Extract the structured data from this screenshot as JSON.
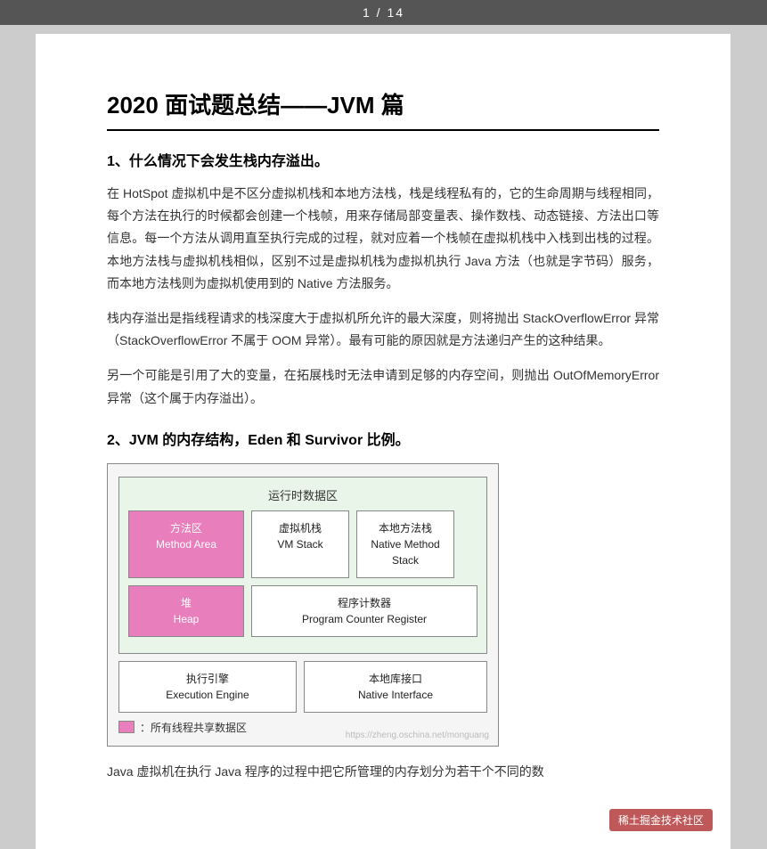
{
  "topbar": {
    "page_indicator": "1 / 14"
  },
  "document": {
    "title": "2020 面试题总结——JVM 篇",
    "section1": {
      "heading": "1、什么情况下会发生栈内存溢出。",
      "paragraphs": [
        "在 HotSpot 虚拟机中是不区分虚拟机栈和本地方法栈，栈是线程私有的，它的生命周期与线程相同，每个方法在执行的时候都会创建一个栈帧，用来存储局部变量表、操作数栈、动态链接、方法出口等信息。每一个方法从调用直至执行完成的过程，就对应着一个栈帧在虚拟机栈中入栈到出栈的过程。本地方法栈与虚拟机栈相似，区别不过是虚拟机栈为虚拟机执行 Java 方法（也就是字节码）服务，而本地方法栈则为虚拟机使用到的 Native 方法服务。",
        "栈内存溢出是指线程请求的栈深度大于虚拟机所允许的最大深度，则将抛出 StackOverflowError 异常（StackOverflowError 不属于 OOM 异常）。最有可能的原因就是方法递归产生的这种结果。",
        "另一个可能是引用了大的变量，在拓展栈时无法申请到足够的内存空间，则抛出 OutOfMemoryError 异常（这个属于内存溢出）。"
      ]
    },
    "section2": {
      "heading": "2、JVM 的内存结构，Eden 和 Survivor 比例。",
      "diagram": {
        "runtime_area_title": "运行时数据区",
        "method_area_zh": "方法区",
        "method_area_en": "Method Area",
        "vm_stack_zh": "虚拟机栈",
        "vm_stack_en": "VM Stack",
        "native_method_zh": "本地方法栈",
        "native_method_en": "Native Method Stack",
        "heap_zh": "堆",
        "heap_en": "Heap",
        "program_counter_zh": "程序计数器",
        "program_counter_en": "Program Counter Register",
        "execution_engine_zh": "执行引擎",
        "execution_engine_en": "Execution Engine",
        "native_interface_zh": "本地库接口",
        "native_interface_en": "Native Interface",
        "legend_text": "：所有线程共享数据区",
        "watermark": "https://zheng.oschina.net/monguang"
      },
      "after_paragraph": "Java 虚拟机在执行 Java 程序的过程中把它所管理的内存划分为若干个不同的数"
    }
  },
  "bottom_watermark": {
    "text": "稀土掘金技术社区"
  }
}
